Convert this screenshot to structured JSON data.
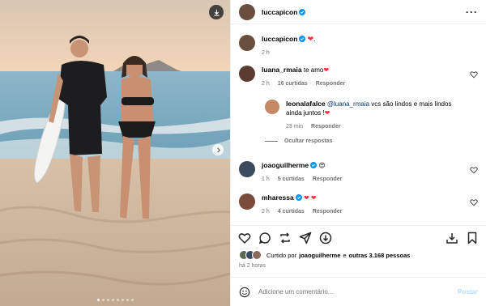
{
  "post": {
    "author": "luccapicon",
    "caption_heart": "❤",
    "caption_tail": ".",
    "caption_time": "2 h"
  },
  "comments": [
    {
      "user": "luana_rmaia",
      "text": "te amo",
      "emoji": "❤",
      "time": "2 h",
      "likes": "16 curtidas",
      "reply": "Responder"
    },
    {
      "user": "leonalafalce",
      "mention": "@luana_rmaia",
      "text": "vcs são lindos e mais lindos ainda juntos !",
      "emoji": "❤",
      "time": "23 min",
      "reply": "Responder"
    },
    {
      "user": "joaoguilherme",
      "emoji": "😍",
      "time": "1 h",
      "likes": "5 curtidas",
      "reply": "Responder"
    },
    {
      "user": "mharessa",
      "emoji": "❤ ❤",
      "time": "2 h",
      "likes": "4 curtidas",
      "reply": "Responder"
    }
  ],
  "hide_replies": "Ocultar respostas",
  "liked_by": {
    "prefix": "Curtido por",
    "user": "joaoguilherme",
    "middle": "e",
    "others": "outras 3.168 pessoas"
  },
  "posted_ago": "há 2 horas",
  "add_comment": {
    "placeholder": "Adicione um comentário...",
    "post_label": "Postar"
  },
  "colors": {
    "heart": "#ff3040",
    "verified": "#0095f6",
    "mention": "#00376b",
    "muted": "#737373",
    "post_disabled": "#b2dffc"
  },
  "icons": [
    "download-icon",
    "chevron-right-icon",
    "more-icon",
    "heart-icon",
    "comment-icon",
    "repost-icon",
    "share-icon",
    "save-icon",
    "emoji-icon",
    "verified-icon"
  ]
}
